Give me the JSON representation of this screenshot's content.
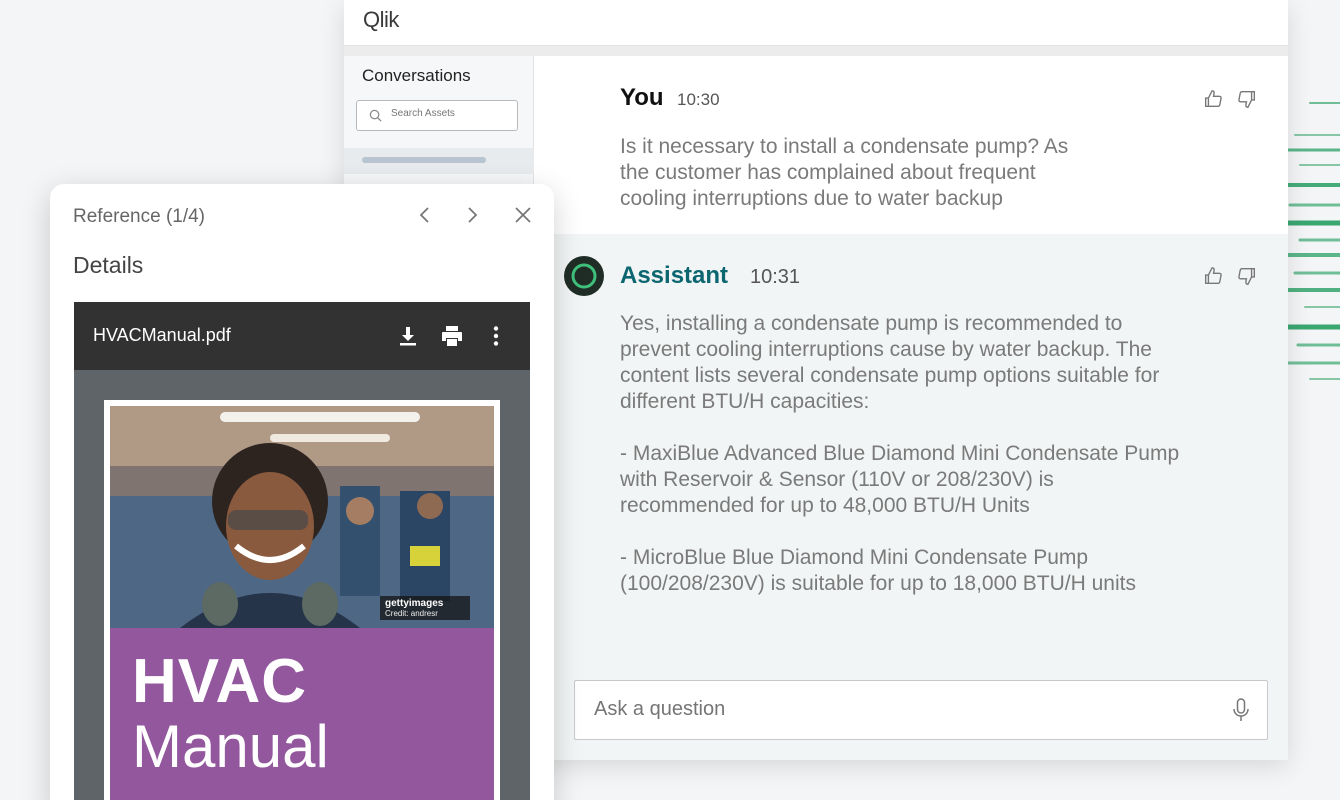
{
  "app": {
    "logo": "Qlik"
  },
  "sidebar": {
    "title": "Conversations",
    "search_placeholder": "Search Assets"
  },
  "messages": [
    {
      "author": "You",
      "time": "10:30",
      "text": "Is it necessary to install a condensate pump? As\nthe customer has complained about frequent\ncooling interruptions due to water backup"
    },
    {
      "author": "Assistant",
      "time": "10:31",
      "text": "Yes, installing a condensate pump is recommended to\nprevent cooling interruptions cause by water backup. The\ncontent lists several condensate pump options suitable for\ndifferent BTU/H capacities:\n\n- MaxiBlue Advanced Blue Diamond Mini Condensate Pump\nwith Reservoir & Sensor (110V or 208/230V) is\nrecommended for up to 48,000 BTU/H Units\n\n- MicroBlue Blue Diamond Mini Condensate Pump\n(100/208/230V) is suitable for up to 18,000 BTU/H units"
    }
  ],
  "composer": {
    "placeholder": "Ask a question"
  },
  "reference": {
    "title": "Reference (1/4)",
    "section": "Details",
    "file_name": "HVACManual.pdf",
    "cover_line1": "HVAC",
    "cover_line2": "Manual",
    "watermark_brand": "gettyimages",
    "watermark_credit": "Credit: andresr"
  },
  "colors": {
    "accent_teal": "#0b6670",
    "brand_green": "#1a8a46",
    "cover_purple": "#92579c"
  }
}
